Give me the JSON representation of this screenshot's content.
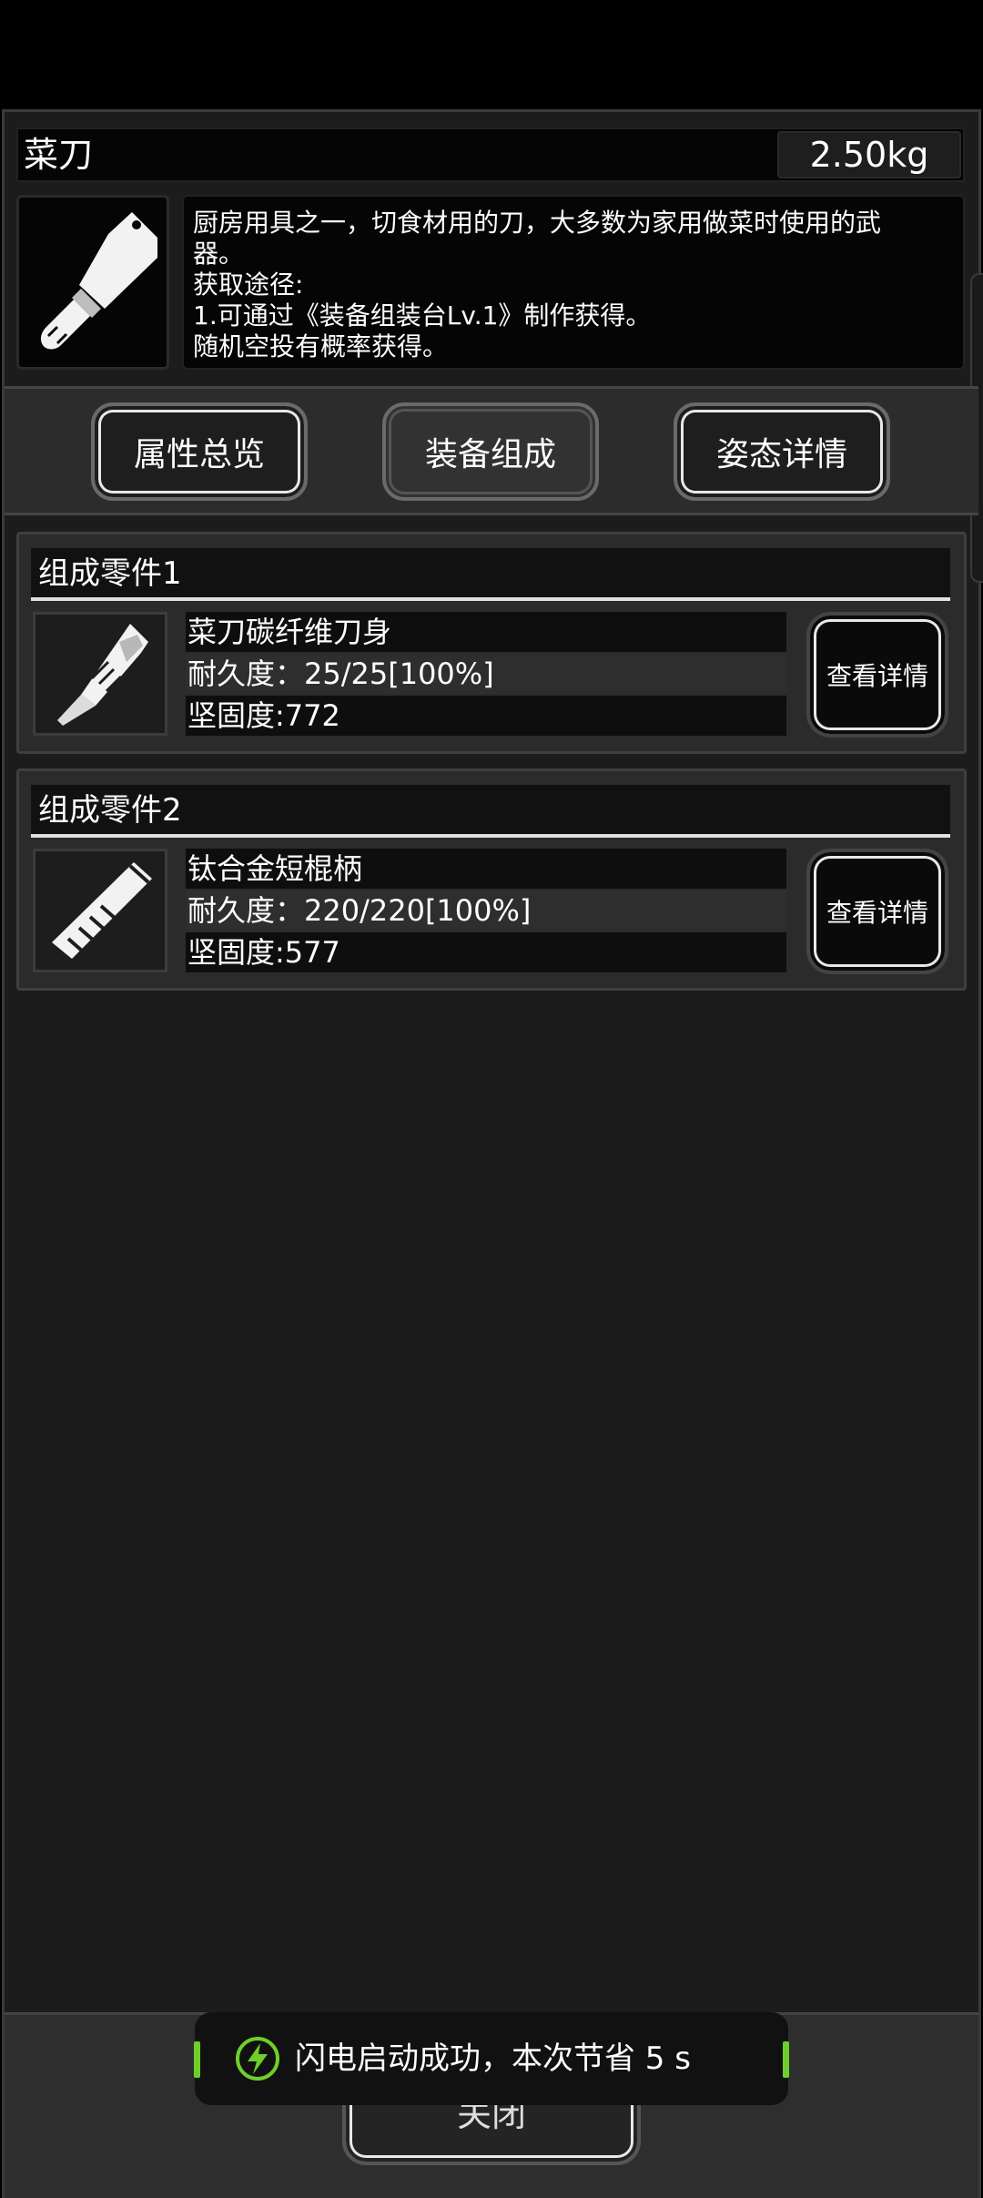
{
  "item": {
    "name": "菜刀",
    "weight": "2.50kg",
    "icon": "cleaver-icon",
    "description": [
      "厨房用具之一，切食材用的刀，大多数为家用做菜时使用的武",
      "器。",
      "获取途径:",
      "1.可通过《装备组装台Lv.1》制作获得。",
      "随机空投有概率获得。"
    ]
  },
  "tabs": [
    {
      "label": "属性总览"
    },
    {
      "label": "装备组成"
    },
    {
      "label": "姿态详情"
    }
  ],
  "parts": [
    {
      "header": "组成零件1",
      "name": "菜刀碳纤维刀身",
      "durability": "耐久度：25/25[100%]",
      "solidity": "坚固度:772",
      "icon": "blade-icon",
      "button": "查看详情"
    },
    {
      "header": "组成零件2",
      "name": "钛合金短棍柄",
      "durability": "耐久度：220/220[100%]",
      "solidity": "坚固度:577",
      "icon": "handle-icon",
      "button": "查看详情"
    }
  ],
  "footer": {
    "close_label": "关闭"
  },
  "toast": {
    "text": "闪电启动成功，本次节省 5 s",
    "icon": "lightning-icon",
    "accent": "#6fcf2a"
  }
}
